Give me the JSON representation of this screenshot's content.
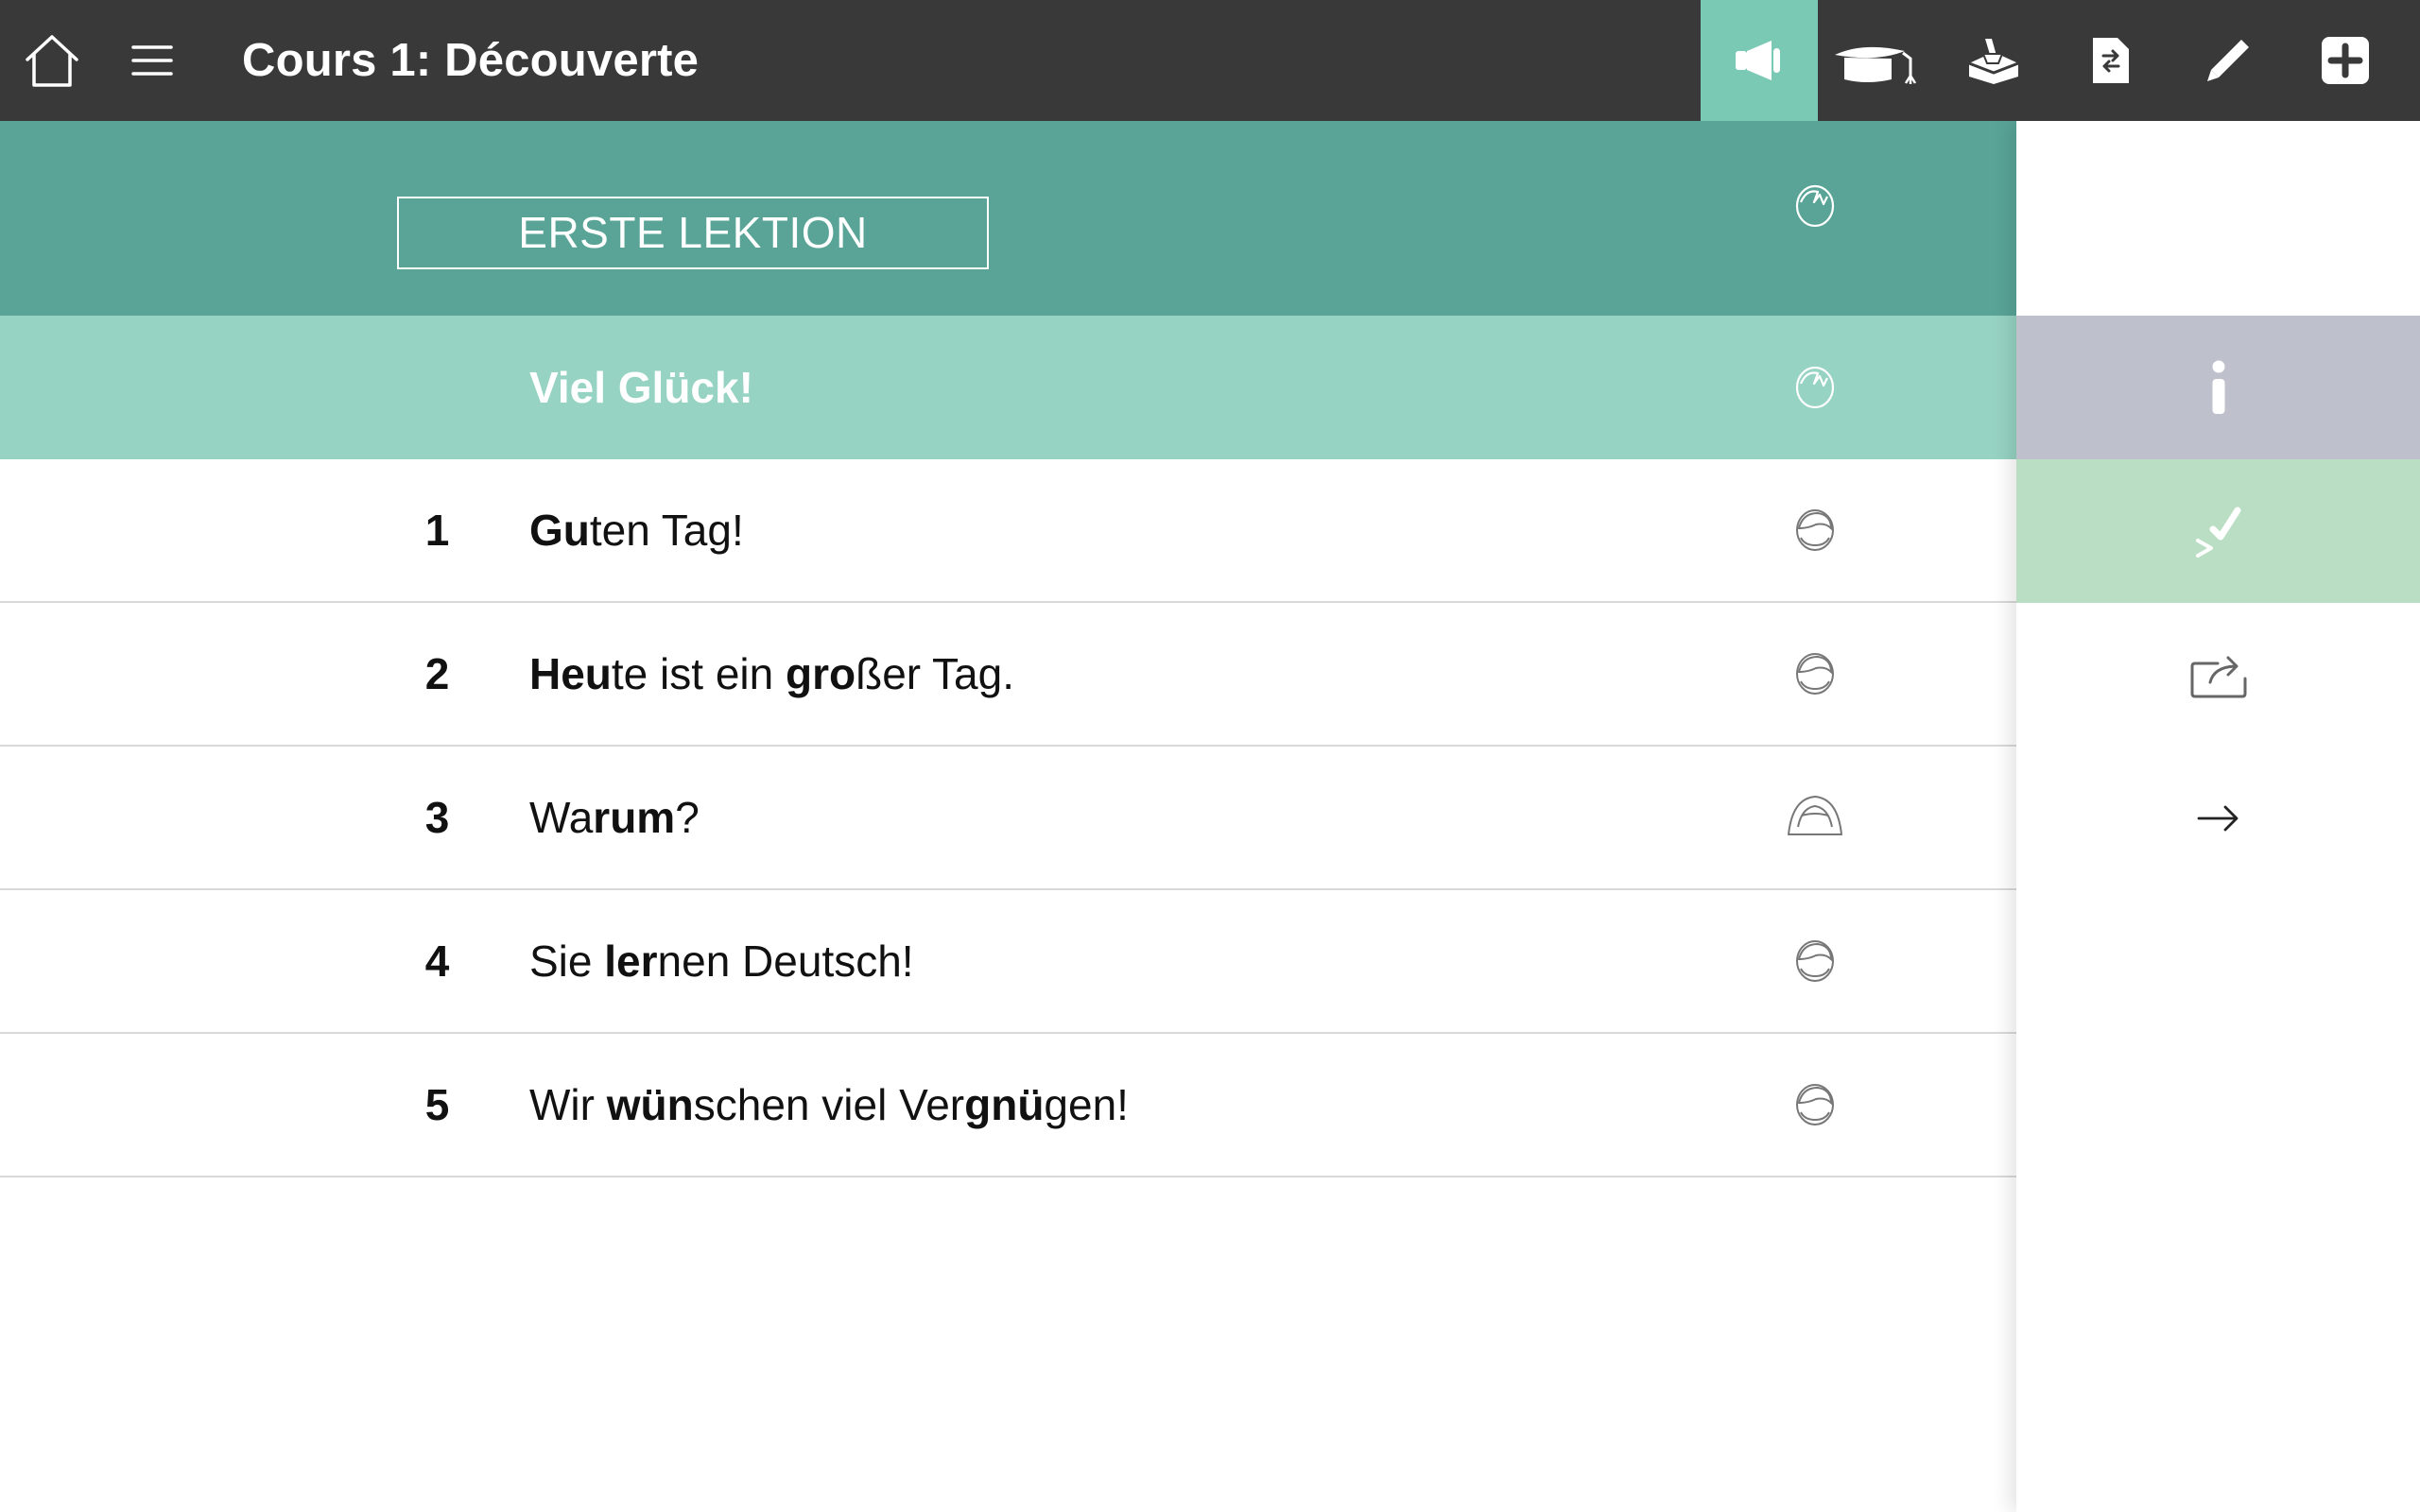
{
  "topbar": {
    "title": "Cours 1: Découverte",
    "icons": {
      "home": "home-icon",
      "menu": "hamburger-menu-icon",
      "audio": "megaphone-icon",
      "course": "graduation-cap-icon",
      "inbox": "inbox-tray-icon",
      "document": "document-swap-icon",
      "pen": "pen-icon",
      "add": "plus-square-icon"
    },
    "active_tool": "audio"
  },
  "lesson": {
    "title": "ERSTE LEKTION",
    "intro": "Viel Glück!",
    "items": [
      {
        "number": "1",
        "segments": [
          {
            "text": "Gu",
            "bold": true
          },
          {
            "text": "ten Tag!",
            "bold": false
          }
        ]
      },
      {
        "number": "2",
        "segments": [
          {
            "text": "Heu",
            "bold": true
          },
          {
            "text": "te ist ein ",
            "bold": false
          },
          {
            "text": "gro",
            "bold": true
          },
          {
            "text": "ßer Tag.",
            "bold": false
          }
        ]
      },
      {
        "number": "3",
        "segments": [
          {
            "text": "Wa",
            "bold": false
          },
          {
            "text": "rum",
            "bold": true
          },
          {
            "text": "?",
            "bold": false
          }
        ]
      },
      {
        "number": "4",
        "segments": [
          {
            "text": "Sie ",
            "bold": false
          },
          {
            "text": "ler",
            "bold": true
          },
          {
            "text": "nen Deutsch!",
            "bold": false
          }
        ]
      },
      {
        "number": "5",
        "segments": [
          {
            "text": "Wir ",
            "bold": false
          },
          {
            "text": "wün",
            "bold": true
          },
          {
            "text": "schen viel Ver",
            "bold": false
          },
          {
            "text": "gnü",
            "bold": true
          },
          {
            "text": "gen!",
            "bold": false
          }
        ]
      }
    ]
  },
  "sidebar": {
    "icons": [
      "info-icon",
      "exercise-check-icon",
      "repeat-share-icon",
      "next-arrow-icon"
    ]
  },
  "colors": {
    "topbar": "#393939",
    "active_tool": "#79c9b5",
    "lesson_header": "#59a497",
    "intro_row": "#96d3c2",
    "info_button": "#bec1cb",
    "exercise_button": "#b9dec3"
  }
}
